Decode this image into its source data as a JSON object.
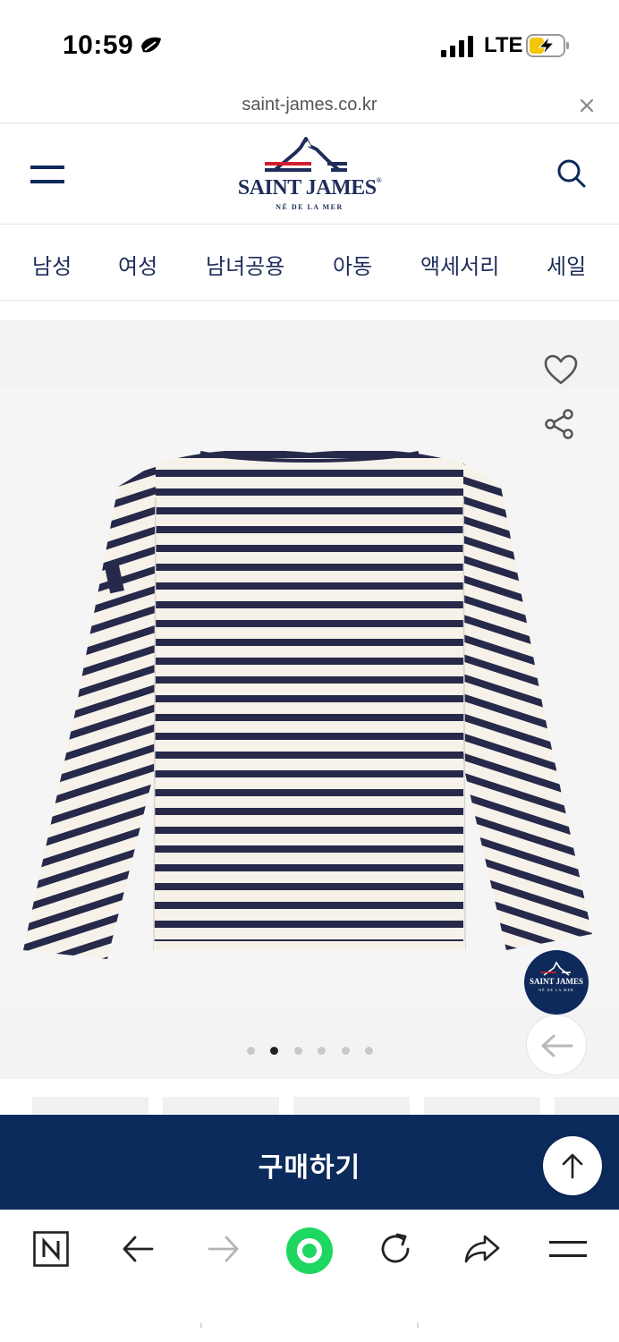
{
  "status_bar": {
    "time": "10:59",
    "network": "LTE"
  },
  "url_bar": {
    "url": "saint-james.co.kr"
  },
  "header": {
    "logo_text": "SAINT JAMES",
    "logo_reg": "®",
    "logo_tagline": "NÉ DE LA MER",
    "brand_colors": {
      "navy": "#1e2d5a",
      "red": "#d0202e"
    }
  },
  "nav": {
    "items": [
      {
        "label": "남성"
      },
      {
        "label": "여성"
      },
      {
        "label": "남녀공용"
      },
      {
        "label": "아동"
      },
      {
        "label": "액세서리"
      },
      {
        "label": "세일"
      }
    ]
  },
  "gallery": {
    "image_alt_icon": "striped-long-sleeve-shirt",
    "pager": {
      "count": 6,
      "active_index": 1
    },
    "bubble_text": "SAINT JAMES",
    "bubble_sub": "NÉ DE LA MER"
  },
  "buy_bar": {
    "label": "구매하기",
    "color": "#0b2b5c"
  },
  "toolbar": {
    "items": [
      "naver-home-icon",
      "back-arrow-icon",
      "forward-arrow-icon",
      "green-dot-icon",
      "reload-icon",
      "share-icon",
      "menu-icon"
    ],
    "accent": "#1ed760"
  }
}
